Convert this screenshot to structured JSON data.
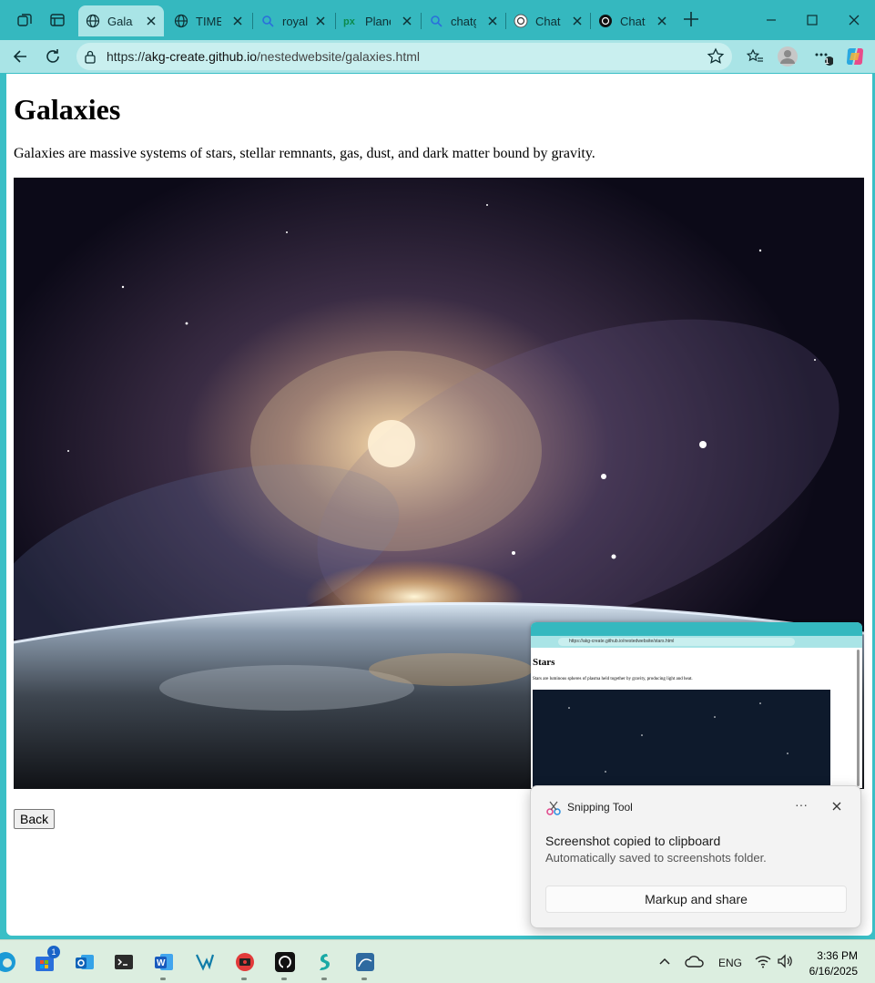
{
  "browser": {
    "tabs": [
      {
        "title": "Galaxies",
        "icon": "globe-icon",
        "active": true
      },
      {
        "title": "TIME for Kids",
        "icon": "globe-icon",
        "active": false
      },
      {
        "title": "royalty free",
        "icon": "search-icon",
        "active": false
      },
      {
        "title": "Planets",
        "icon": "pexels-icon",
        "active": false
      },
      {
        "title": "chatgpt",
        "icon": "search-icon",
        "active": false
      },
      {
        "title": "ChatGPT",
        "icon": "chatgpt-icon",
        "active": false
      },
      {
        "title": "ChatGPT",
        "icon": "chatgpt-icon",
        "active": false
      }
    ],
    "address": {
      "scheme": "https://",
      "host": "akg-create.github.io",
      "path": "/nestedwebsite/galaxies.html"
    },
    "profile_badge": "1"
  },
  "page": {
    "title": "Galaxies",
    "description": "Galaxies are massive systems of stars, stellar remnants, gas, dust, and dark matter bound by gravity.",
    "image_description": "galaxy-over-earth-image",
    "back_label": "Back"
  },
  "snip_preview": {
    "title": "Stars",
    "description": "Stars are luminous spheres of plasma held together by gravity, producing light and heat.",
    "url": "https://akg-create.github.io/nestedwebsite/stars.html"
  },
  "notification": {
    "app": "Snipping Tool",
    "heading": "Screenshot copied to clipboard",
    "body": "Automatically saved to screenshots folder.",
    "action": "Markup and share"
  },
  "taskbar": {
    "store_badge": "1",
    "language": "ENG",
    "time": "3:36 PM",
    "date": "6/16/2025"
  },
  "colors": {
    "tabstrip": "#35b8bf",
    "toolbar": "#a9e4e6",
    "taskbar": "#dceee0"
  }
}
